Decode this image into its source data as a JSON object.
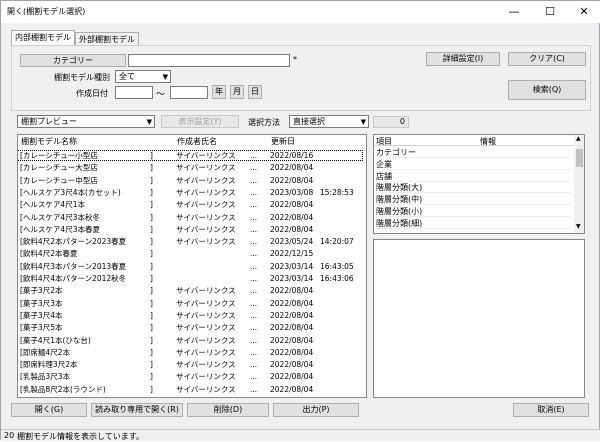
{
  "window": {
    "title": "開く(棚割モデル選択)",
    "minimize": "—",
    "maximize": "☐",
    "close": "✕"
  },
  "tabs": [
    {
      "label": "内部棚割モデル"
    },
    {
      "label": "外部棚割モデル"
    }
  ],
  "filters": {
    "category_button": "カテゴリー",
    "category_value": "",
    "category_mark": "*",
    "model_type_label": "棚割モデル種別",
    "model_type_value": "全て",
    "date_label": "作成日付",
    "date_from": "",
    "date_sep": "〜",
    "date_to": "",
    "year_btn": "年",
    "month_btn": "月",
    "day_btn": "日"
  },
  "buttons": {
    "detail": "詳細設定(I)",
    "clear": "クリア(C)",
    "search": "検索(Q)",
    "preview_setting": "表示設定(Y)",
    "open": "開く(G)",
    "open_readonly": "読み取り専用で開く(R)",
    "delete": "削除(D)",
    "output": "出力(P)",
    "cancel": "取消(E)"
  },
  "preview": {
    "select_value": "棚割プレビュー",
    "method_label": "選択方法",
    "method_value": "直接選択",
    "count": "0"
  },
  "table": {
    "headers": [
      "棚割モデル名称",
      "作成者氏名",
      "更新日"
    ],
    "rows": [
      {
        "name": "[カレーシチュー小型店",
        "bracket": "]",
        "author": "サイバーリンクス",
        "dots": "...",
        "date": "2022/08/16",
        "time": ""
      },
      {
        "name": "[カレーシチュー大型店",
        "bracket": "]",
        "author": "サイバーリンクス",
        "dots": "...",
        "date": "2022/08/04",
        "time": ""
      },
      {
        "name": "[カレーシチュー中型店",
        "bracket": "]",
        "author": "サイバーリンクス",
        "dots": "...",
        "date": "2022/08/04",
        "time": ""
      },
      {
        "name": "[ヘルスケア3尺4本(カセット)",
        "bracket": "]",
        "author": "サイバーリンクス",
        "dots": "...",
        "date": "2023/03/08",
        "time": "15:28:53"
      },
      {
        "name": "[ヘルスケア4尺1本",
        "bracket": "]",
        "author": "サイバーリンクス",
        "dots": "...",
        "date": "2022/08/04",
        "time": ""
      },
      {
        "name": "[ヘルスケア4尺3本秋冬",
        "bracket": "]",
        "author": "サイバーリンクス",
        "dots": "...",
        "date": "2022/08/04",
        "time": ""
      },
      {
        "name": "[ヘルスケア4尺3本春夏",
        "bracket": "]",
        "author": "サイバーリンクス",
        "dots": "...",
        "date": "2022/08/04",
        "time": ""
      },
      {
        "name": "[飲料4尺2本パターン2023春夏",
        "bracket": "]",
        "author": "サイバーリンクス",
        "dots": "...",
        "date": "2023/05/24",
        "time": "14:20:07"
      },
      {
        "name": "[飲料4尺2本春夏",
        "bracket": "]",
        "author": "",
        "dots": "...",
        "date": "2022/12/15",
        "time": ""
      },
      {
        "name": "[飲料4尺3本パターン2013春夏",
        "bracket": "]",
        "author": "",
        "dots": "...",
        "date": "2023/03/14",
        "time": "16:43:05"
      },
      {
        "name": "[飲料4尺4本パターン2012秋冬",
        "bracket": "]",
        "author": "",
        "dots": "...",
        "date": "2023/03/14",
        "time": "16:43:06"
      },
      {
        "name": "[菓子3尺2本",
        "bracket": "]",
        "author": "サイバーリンクス",
        "dots": "...",
        "date": "2022/08/04",
        "time": ""
      },
      {
        "name": "[菓子3尺3本",
        "bracket": "]",
        "author": "サイバーリンクス",
        "dots": "...",
        "date": "2022/08/04",
        "time": ""
      },
      {
        "name": "[菓子3尺4本",
        "bracket": "]",
        "author": "サイバーリンクス",
        "dots": "...",
        "date": "2022/08/04",
        "time": ""
      },
      {
        "name": "[菓子3尺5本",
        "bracket": "]",
        "author": "サイバーリンクス",
        "dots": "...",
        "date": "2022/08/04",
        "time": ""
      },
      {
        "name": "[菓子4尺1本(ひな台)",
        "bracket": "]",
        "author": "サイバーリンクス",
        "dots": "...",
        "date": "2022/08/04",
        "time": ""
      },
      {
        "name": "[即席麺4尺2本",
        "bracket": "]",
        "author": "サイバーリンクス",
        "dots": "...",
        "date": "2022/08/04",
        "time": ""
      },
      {
        "name": "[即席料理3尺2本",
        "bracket": "]",
        "author": "サイバーリンクス",
        "dots": "...",
        "date": "2022/08/04",
        "time": ""
      },
      {
        "name": "[乳製品3尺3本",
        "bracket": "]",
        "author": "サイバーリンクス",
        "dots": "...",
        "date": "2022/08/04",
        "time": ""
      },
      {
        "name": "[乳製品8尺2本(ラウンド)",
        "bracket": "]",
        "author": "サイバーリンクス",
        "dots": "...",
        "date": "2022/08/04",
        "time": ""
      }
    ]
  },
  "info": {
    "headers": [
      "項目",
      "情報"
    ],
    "rows": [
      "カテゴリー",
      "企業",
      "店舗",
      "階層分類(大)",
      "階層分類(中)",
      "階層分類(小)",
      "階層分類(細)"
    ]
  },
  "status": {
    "code": "20",
    "text": "棚割モデル情報を表示しています。"
  },
  "colors": {
    "accent": "#0078d7",
    "window_bg": "#f0f0f0",
    "list_bg": "#ffffff"
  }
}
